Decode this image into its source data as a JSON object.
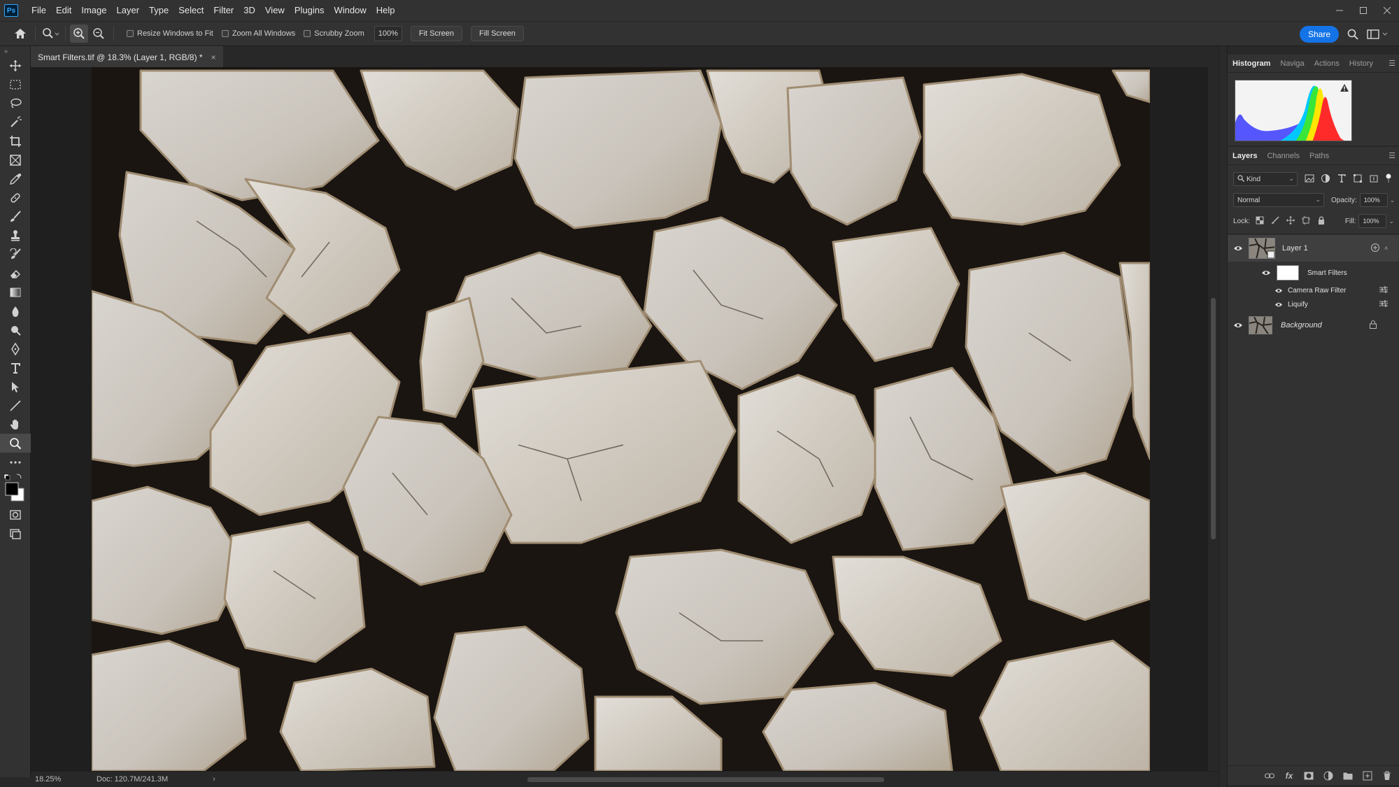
{
  "menubar": {
    "logo": "Ps",
    "items": [
      "File",
      "Edit",
      "Image",
      "Layer",
      "Type",
      "Select",
      "Filter",
      "3D",
      "View",
      "Plugins",
      "Window",
      "Help"
    ]
  },
  "options": {
    "resize_windows": "Resize Windows to Fit",
    "zoom_all": "Zoom All Windows",
    "scrubby": "Scrubby Zoom",
    "zoom_value": "100%",
    "fit_screen": "Fit Screen",
    "fill_screen": "Fill Screen",
    "share": "Share"
  },
  "document": {
    "tab_title": "Smart Filters.tif @ 18.3% (Layer 1, RGB/8) *",
    "tab_close": "×"
  },
  "status": {
    "zoom": "18.25%",
    "doc_size": "Doc: 120.7M/241.3M",
    "arrow": "›"
  },
  "histogram_panel": {
    "tabs": [
      "Histogram",
      "Naviga",
      "Actions",
      "History"
    ]
  },
  "layers_panel": {
    "tabs": [
      "Layers",
      "Channels",
      "Paths"
    ],
    "kind": "Kind",
    "blend_mode": "Normal",
    "opacity_label": "Opacity:",
    "opacity_value": "100%",
    "lock_label": "Lock:",
    "fill_label": "Fill:",
    "fill_value": "100%",
    "layers": {
      "layer1": "Layer 1",
      "smart_filters": "Smart Filters",
      "filter1": "Camera Raw Filter",
      "filter2": "Liquify",
      "background": "Background"
    }
  },
  "colors": {
    "accent": "#1473e6",
    "panel_bg": "#323232",
    "app_bg": "#282828"
  }
}
